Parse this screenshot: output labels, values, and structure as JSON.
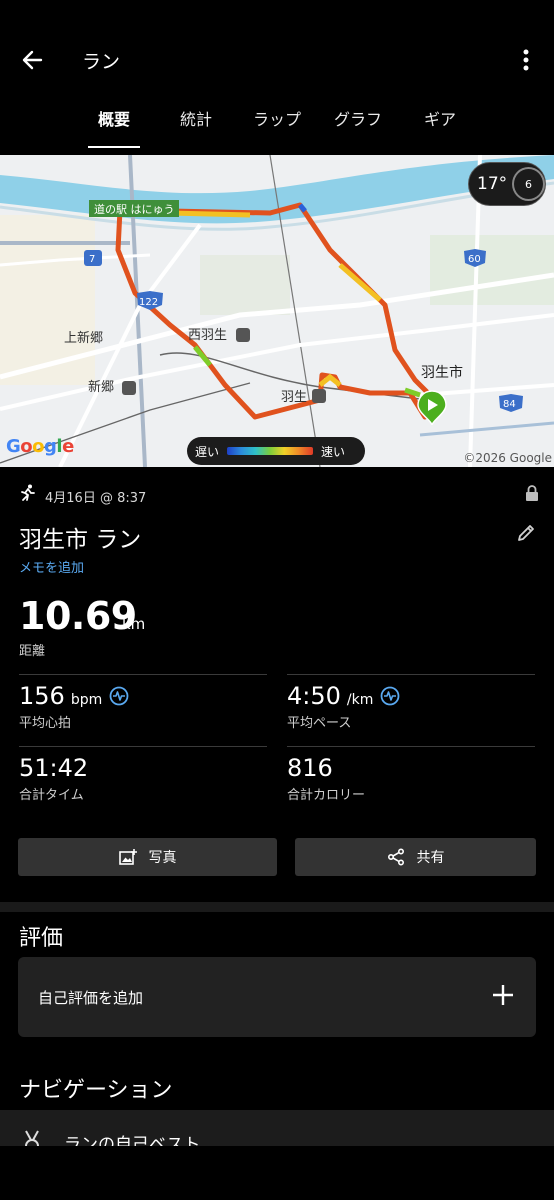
{
  "appbar": {
    "title": "ラン"
  },
  "tabs": [
    {
      "label": "概要",
      "active": true
    },
    {
      "label": "統計",
      "active": false
    },
    {
      "label": "ラップ",
      "active": false
    },
    {
      "label": "グラフ",
      "active": false
    },
    {
      "label": "ギア",
      "active": false
    }
  ],
  "map": {
    "weather": {
      "temperature": "17°",
      "wind_value": "6"
    },
    "legend": {
      "slow": "遅い",
      "fast": "速い"
    },
    "labels": {
      "michi_no_eki": "道の駅 はにゅう",
      "nishi_hanyu": "西羽生",
      "kami_shingo": "上新郷",
      "shingo": "新郷",
      "hanyu_shi": "羽生市",
      "hanyu": "羽生",
      "route_7": "7",
      "route_122": "122",
      "route_60": "60",
      "route_84": "84"
    },
    "google_logo": "Google",
    "copyright": "©2026 Google"
  },
  "activity": {
    "datetime": "4月16日 @ 8:37",
    "name": "羽生市 ラン",
    "add_memo": "メモを追加",
    "distance": {
      "value": "10.69",
      "unit": "km",
      "label": "距離"
    },
    "stats": {
      "avg_hr": {
        "value": "156",
        "unit": "bpm",
        "label": "平均心拍"
      },
      "avg_pace": {
        "value": "4:50",
        "unit": "/km",
        "label": "平均ペース"
      },
      "total_time": {
        "value": "51:42",
        "label": "合計タイム"
      },
      "total_calories": {
        "value": "816",
        "label": "合計カロリー"
      }
    }
  },
  "actions": {
    "photo": "写真",
    "share": "共有"
  },
  "rating": {
    "title": "評価",
    "add_label": "自己評価を追加"
  },
  "navigation": {
    "title": "ナビゲーション",
    "first_item": "ランの自己ベスト"
  },
  "colors": {
    "accent_blue": "#5aa9f0",
    "start_marker": "#4caf1e",
    "card_bg": "#222222"
  }
}
